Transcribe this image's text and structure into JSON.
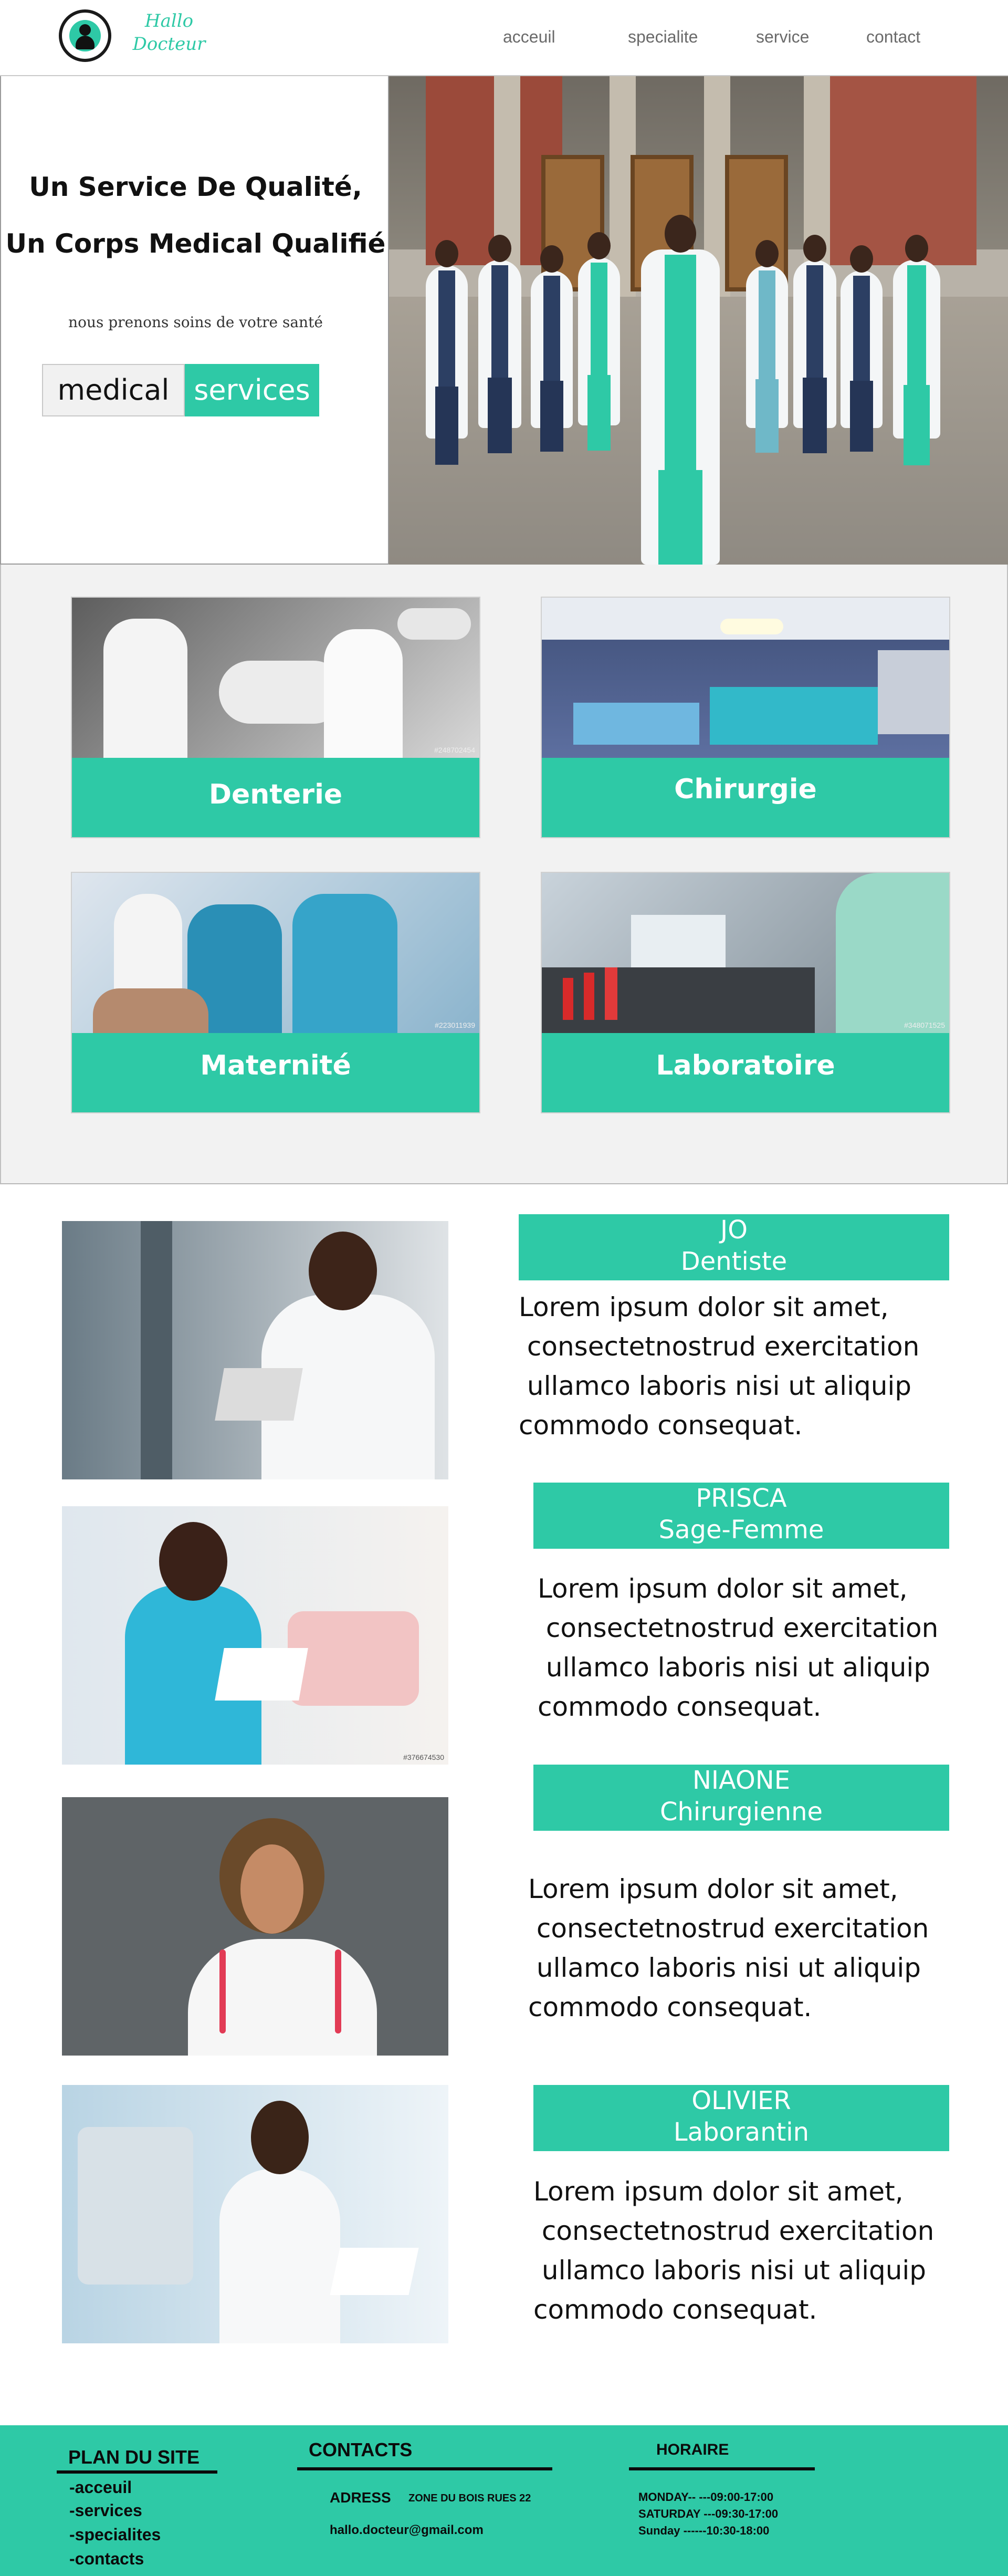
{
  "header": {
    "logo_line1": "Hallo",
    "logo_line2": "Docteur",
    "nav": [
      "acceuil",
      "specialite",
      "service",
      "contact"
    ]
  },
  "hero": {
    "title_line1": "Un Service De Qualité,",
    "title_line2": "Un Corps Medical Qualifié",
    "subtitle": "nous prenons soins de votre santé",
    "button_left": "medical",
    "button_right": "services"
  },
  "services": [
    {
      "label": "Denterie",
      "stock_id": "#248702454"
    },
    {
      "label": "Chirurgie",
      "stock_id": ""
    },
    {
      "label": "Maternité",
      "stock_id": "#223011939"
    },
    {
      "label": "Laboratoire",
      "stock_id": "#348071525"
    }
  ],
  "team": [
    {
      "name": "JO",
      "role": "Dentiste",
      "text": "Lorem ipsum dolor sit amet,\n consectetnostrud exercitation\n ullamco laboris nisi ut aliquip\ncommodo consequat."
    },
    {
      "name": "PRISCA",
      "role": "Sage-Femme",
      "text": "Lorem ipsum dolor sit amet,\n consectetnostrud exercitation\n ullamco laboris nisi ut aliquip\ncommodo consequat."
    },
    {
      "name": "NIAONE",
      "role": "Chirurgienne",
      "text": "Lorem ipsum dolor sit amet,\n consectetnostrud exercitation\n ullamco laboris nisi ut aliquip\ncommodo consequat."
    },
    {
      "name": "OLIVIER",
      "role": "Laborantin",
      "text": "Lorem ipsum dolor sit amet,\n consectetnostrud exercitation\n ullamco laboris nisi ut aliquip\ncommodo consequat."
    }
  ],
  "team_stock_id": "#376674530",
  "footer": {
    "plan_title": "PLAN DU SITE",
    "plan_items": [
      "-acceuil",
      "-services",
      "-specialites",
      "-contacts"
    ],
    "contacts_title": "CONTACTS",
    "adress_label": "ADRESS",
    "adress_value": "ZONE DU BOIS RUES 22",
    "email": "hallo.docteur@gmail.com",
    "horaire_title": "HORAIRE",
    "hours": [
      "MONDAY-- ---09:00-17:00",
      "SATURDAY ---09:30-17:00",
      "Sunday ------10:30-18:00"
    ]
  },
  "colors": {
    "accent": "#2ec9a6",
    "panel": "#f2f2f2"
  }
}
